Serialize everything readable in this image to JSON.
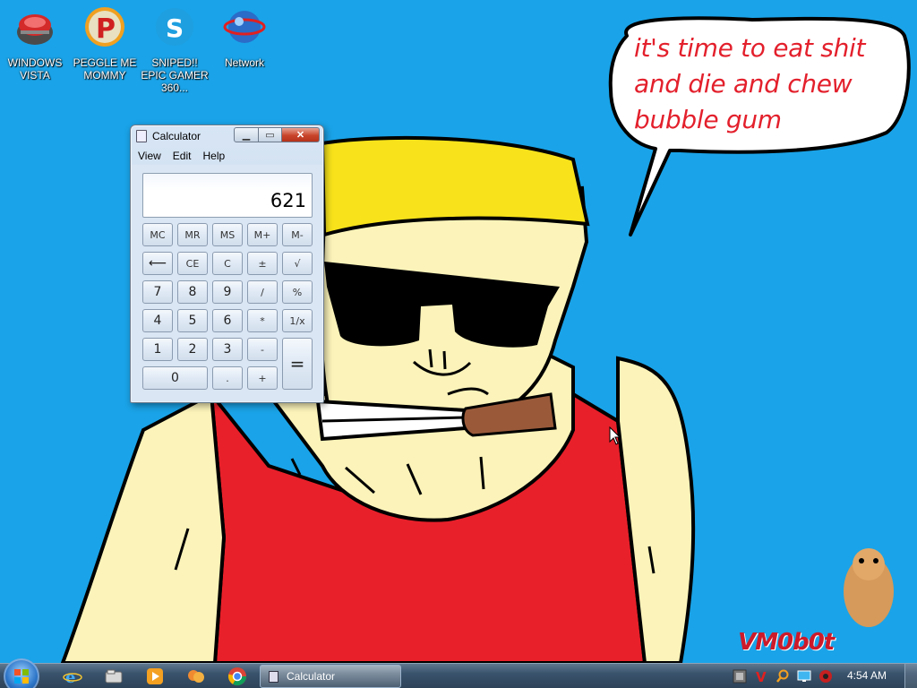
{
  "desktop": {
    "icons": [
      {
        "label": "WINDOWS VISTA",
        "icon": "windows-vista-icon"
      },
      {
        "label": "PEGGLE ME MOMMY",
        "icon": "peggle-icon"
      },
      {
        "label": "SNIPED!! EPIC GAMER 360...",
        "icon": "skype-icon"
      },
      {
        "label": "Network",
        "icon": "network-icon"
      }
    ],
    "speech_bubble": {
      "line1": "it's time to eat shit",
      "line2": "and die and chew",
      "line3": "bubble gum"
    },
    "watermark": "VM0b0t"
  },
  "calculator": {
    "title": "Calculator",
    "menu": [
      "View",
      "Edit",
      "Help"
    ],
    "display": "621",
    "keys": {
      "row1": [
        "MC",
        "MR",
        "MS",
        "M+",
        "M-"
      ],
      "row2": [
        "⟵",
        "CE",
        "C",
        "±",
        "√"
      ],
      "row3": [
        "7",
        "8",
        "9",
        "/",
        "%"
      ],
      "row4": [
        "4",
        "5",
        "6",
        "*",
        "1/x"
      ],
      "row5": [
        "1",
        "2",
        "3",
        "-",
        "="
      ],
      "row6": [
        "0",
        ".",
        "+"
      ]
    }
  },
  "taskbar": {
    "pinned": [
      "internet-explorer-icon",
      "windows-explorer-icon",
      "media-player-icon",
      "chat-icon",
      "chrome-icon"
    ],
    "active_window": "Calculator",
    "tray_icons": [
      "tray-app-icon",
      "tray-v-icon",
      "tray-search-icon",
      "tray-monitor-icon",
      "tray-volume-icon"
    ],
    "clock": "4:54 AM"
  },
  "colors": {
    "desktop_bg": "#1aa3e8",
    "bubble_text": "#e3202c",
    "hair": "#f7e21b",
    "skin": "#fbf3b9",
    "shirt": "#e8202a"
  }
}
